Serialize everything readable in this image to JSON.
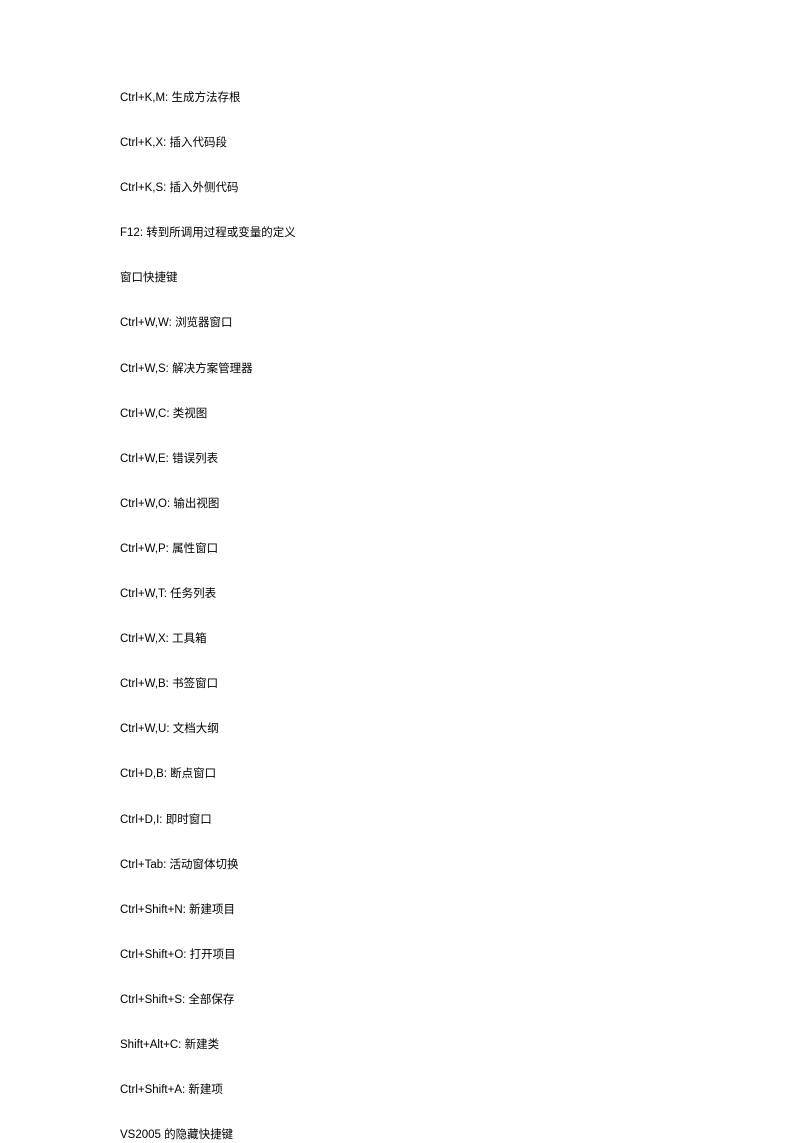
{
  "lines": [
    {
      "shortcut": "Ctrl+K,M:",
      "description": "生成方法存根"
    },
    {
      "shortcut": "Ctrl+K,X:",
      "description": "插入代码段"
    },
    {
      "shortcut": "Ctrl+K,S:",
      "description": "插入外侧代码"
    },
    {
      "shortcut": "F12:",
      "description": "转到所调用过程或变量的定义"
    },
    {
      "shortcut": "",
      "description": "窗口快捷键"
    },
    {
      "shortcut": "Ctrl+W,W:",
      "description": "浏览器窗口"
    },
    {
      "shortcut": "Ctrl+W,S:",
      "description": "解决方案管理器"
    },
    {
      "shortcut": "Ctrl+W,C:",
      "description": "类视图"
    },
    {
      "shortcut": "Ctrl+W,E:",
      "description": "错误列表"
    },
    {
      "shortcut": "Ctrl+W,O:",
      "description": "输出视图"
    },
    {
      "shortcut": "Ctrl+W,P:",
      "description": "属性窗口"
    },
    {
      "shortcut": "Ctrl+W,T:",
      "description": "任务列表"
    },
    {
      "shortcut": "Ctrl+W,X:",
      "description": "工具箱"
    },
    {
      "shortcut": "Ctrl+W,B:",
      "description": "书签窗口"
    },
    {
      "shortcut": "Ctrl+W,U:",
      "description": "文档大纲"
    },
    {
      "shortcut": "Ctrl+D,B:",
      "description": "断点窗口"
    },
    {
      "shortcut": "Ctrl+D,I:",
      "description": "即时窗口"
    },
    {
      "shortcut": "Ctrl+Tab:",
      "description": "活动窗体切换"
    },
    {
      "shortcut": "Ctrl+Shift+N:",
      "description": "新建项目"
    },
    {
      "shortcut": "Ctrl+Shift+O:",
      "description": "打开项目"
    },
    {
      "shortcut": "Ctrl+Shift+S:",
      "description": "全部保存"
    },
    {
      "shortcut": "Shift+Alt+C:",
      "description": "新建类"
    },
    {
      "shortcut": "Ctrl+Shift+A:",
      "description": "新建项"
    },
    {
      "shortcut": "",
      "description": "VS2005 的隐藏快捷键"
    }
  ]
}
